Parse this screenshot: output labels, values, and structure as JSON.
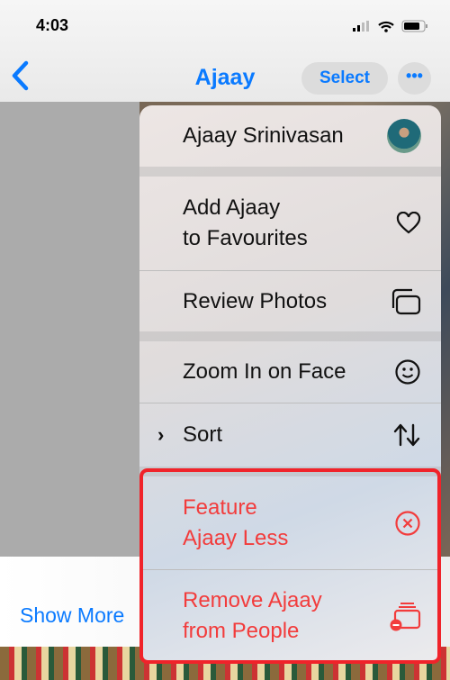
{
  "status_bar": {
    "time": "4:03"
  },
  "nav": {
    "back_icon": "chevron-left-icon",
    "title": "Ajaay",
    "select_label": "Select",
    "more_icon": "ellipsis-icon"
  },
  "content": {
    "show_more": "Show More"
  },
  "menu": {
    "person_name": "Ajaay Srinivasan",
    "items": [
      {
        "label_line1": "Add Ajaay",
        "label_line2": "to Favourites",
        "icon": "heart-icon"
      },
      {
        "label": "Review Photos",
        "icon": "photos-stack-icon"
      },
      {
        "label": "Zoom In on Face",
        "icon": "smiley-face-icon"
      },
      {
        "label": "Sort",
        "icon": "sort-arrows-icon"
      },
      {
        "label_line1": "Feature",
        "label_line2": "Ajaay Less",
        "icon": "x-circle-icon",
        "destructive": true
      },
      {
        "label_line1": "Remove Ajaay",
        "label_line2": "from People",
        "icon": "remove-person-icon",
        "destructive": true
      }
    ]
  },
  "colors": {
    "accent": "#0a7aff",
    "destructive": "#f23c3c",
    "highlight": "#f0232a"
  }
}
